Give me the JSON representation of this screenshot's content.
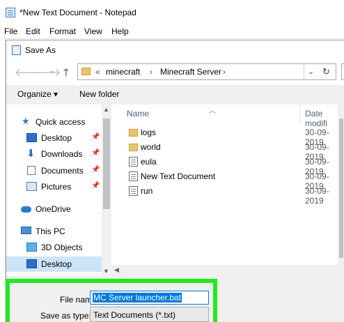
{
  "notepad": {
    "title": "*New Text Document - Notepad",
    "menu": [
      "File",
      "Edit",
      "Format",
      "View",
      "Help"
    ]
  },
  "dialog": {
    "title": "Save As",
    "nav": {
      "back_icon": "arrow-left-icon",
      "forward_icon": "arrow-right-icon",
      "up_icon": "arrow-up-icon",
      "up_glyph": "🡑"
    },
    "address": {
      "overflow": "«",
      "segments": [
        "minecraft",
        "Minecraft Server"
      ],
      "separator": "›",
      "dropdown_glyph": "⌄",
      "refresh_glyph": "↻"
    },
    "toolbar": {
      "organize": "Organize ▾",
      "new_folder": "New folder"
    },
    "sidebar": {
      "items": [
        {
          "label": "Quick access",
          "icon": "star-icon",
          "pinned": false
        },
        {
          "label": "Desktop",
          "icon": "desktop-icon",
          "pinned": true
        },
        {
          "label": "Downloads",
          "icon": "download-icon",
          "pinned": true
        },
        {
          "label": "Documents",
          "icon": "documents-icon",
          "pinned": true
        },
        {
          "label": "Pictures",
          "icon": "pictures-icon",
          "pinned": true
        },
        {
          "label": "OneDrive",
          "icon": "cloud-icon",
          "pinned": false
        },
        {
          "label": "This PC",
          "icon": "computer-icon",
          "pinned": false
        },
        {
          "label": "3D Objects",
          "icon": "cube-icon",
          "pinned": false
        },
        {
          "label": "Desktop",
          "icon": "desktop-icon",
          "pinned": false,
          "selected": true
        }
      ],
      "pin_glyph": "📌"
    },
    "columns": {
      "name": "Name",
      "date": "Date modifi"
    },
    "files": [
      {
        "name": "logs",
        "type": "folder",
        "date": "30-09-2019"
      },
      {
        "name": "world",
        "type": "folder",
        "date": "30-09-2019"
      },
      {
        "name": "eula",
        "type": "document",
        "date": "30-09-2019"
      },
      {
        "name": "New Text Document",
        "type": "document",
        "date": "30-09-2019"
      },
      {
        "name": "run",
        "type": "document",
        "date": "30-09-2019"
      }
    ],
    "form": {
      "file_name_label": "File name:",
      "file_name_value": "MC Server launcher.bat",
      "save_as_type_label": "Save as type:",
      "save_as_type_value": "Text Documents (*.txt)"
    }
  },
  "colors": {
    "highlight": "#22e822",
    "selection": "#0078d7",
    "nav_selected": "#cce4f7",
    "folder": "#e8c46a"
  }
}
